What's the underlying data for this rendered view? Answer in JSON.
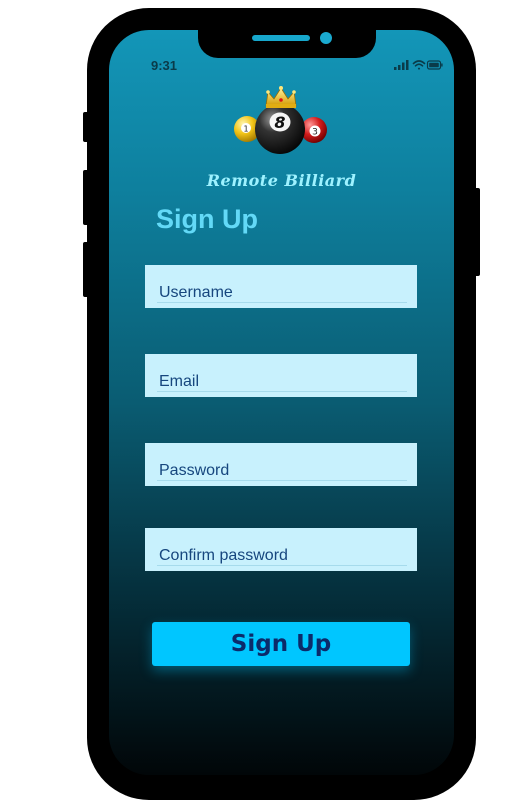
{
  "status_bar": {
    "time": "9:31"
  },
  "brand": {
    "name": "Remote Billiard"
  },
  "logo": {
    "ball_left": "1",
    "ball_center": "8",
    "ball_right": "3"
  },
  "form": {
    "title": "Sign Up",
    "fields": [
      {
        "placeholder": "Username"
      },
      {
        "placeholder": "Email"
      },
      {
        "placeholder": "Password"
      },
      {
        "placeholder": "Confirm password"
      }
    ],
    "submit_label": "Sign Up"
  },
  "colors": {
    "accent": "#00c6ff",
    "title": "#63d9f7",
    "field_bg": "#c8f1fd",
    "button_text": "#0b2a6a"
  }
}
